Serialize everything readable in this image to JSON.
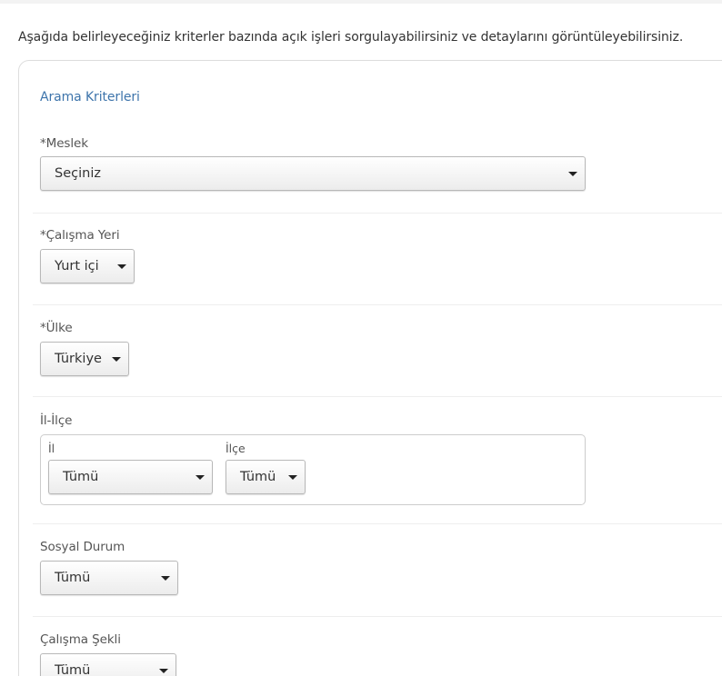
{
  "intro_text": "Aşağıda belirleyeceğiniz kriterler bazında açık işleri sorgulayabilirsiniz ve detaylarını görüntüleyebilirsiniz.",
  "panel_title": "Arama Kriterleri",
  "fields": {
    "meslek": {
      "label": "Meslek",
      "required_mark": "*",
      "value": "Seçiniz"
    },
    "calisma_yeri": {
      "label": "Çalışma Yeri",
      "required_mark": "*",
      "value": "Yurt içi"
    },
    "ulke": {
      "label": "Ülke",
      "required_mark": "*",
      "value": "Türkiye"
    },
    "il_ilce": {
      "label": "İl-İlçe",
      "il_label": "İl",
      "il_value": "Tümü",
      "ilce_label": "İlçe",
      "ilce_value": "Tümü"
    },
    "sosyal_durum": {
      "label": "Sosyal Durum",
      "value": "Tümü"
    },
    "calisma_sekli": {
      "label": "Çalışma Şekli",
      "value": "Tümü"
    }
  },
  "colors": {
    "accent": "#3d74ab",
    "text": "#333333",
    "border": "#b8b8b8"
  },
  "icons": {
    "dropdown": "caret-down-icon"
  }
}
